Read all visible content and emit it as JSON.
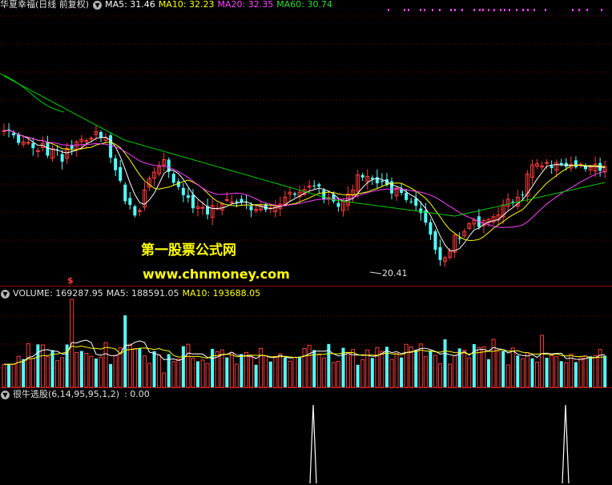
{
  "main_panel": {
    "stock_name": "华夏幸福(日线 前复权)",
    "ma5": "MA5: 31.46",
    "ma10": "MA10: 32.23",
    "ma20": "MA20: 32.35",
    "ma60": "MA60: 30.74",
    "low_label": "20.41",
    "watermark_name": "第一股票公式网",
    "watermark_url": "www.chnmoney.com"
  },
  "volume_panel": {
    "volume": "VOLUME: 169287.95",
    "ma5": "MA5: 188591.05",
    "ma10": "MA10: 193688.05",
    "marker": "$"
  },
  "indicator_panel": {
    "name": "很牛选股(6,14,95,95,1,2)",
    "value": ": 0.00"
  },
  "colors": {
    "up": "#ff3c3c",
    "down": "#54ffff",
    "ma5": "#ffffff",
    "ma10": "#ffff00",
    "ma20": "#ff44ff",
    "ma60": "#00cc00",
    "grid": "#7a0000"
  },
  "chart_data": {
    "type": "candlestick",
    "period": "daily",
    "low_annotation": 20.41,
    "price_ma": {
      "MA5": 31.46,
      "MA10": 32.23,
      "MA20": 32.35,
      "MA60": 30.74
    },
    "volume": {
      "last": 169287.95,
      "MA5": 188591.05,
      "MA10": 193688.05
    },
    "indicator": {
      "name": "很牛选股",
      "params": [
        6,
        14,
        95,
        95,
        1,
        2
      ],
      "value": 0.0,
      "signal_count": 2
    }
  }
}
